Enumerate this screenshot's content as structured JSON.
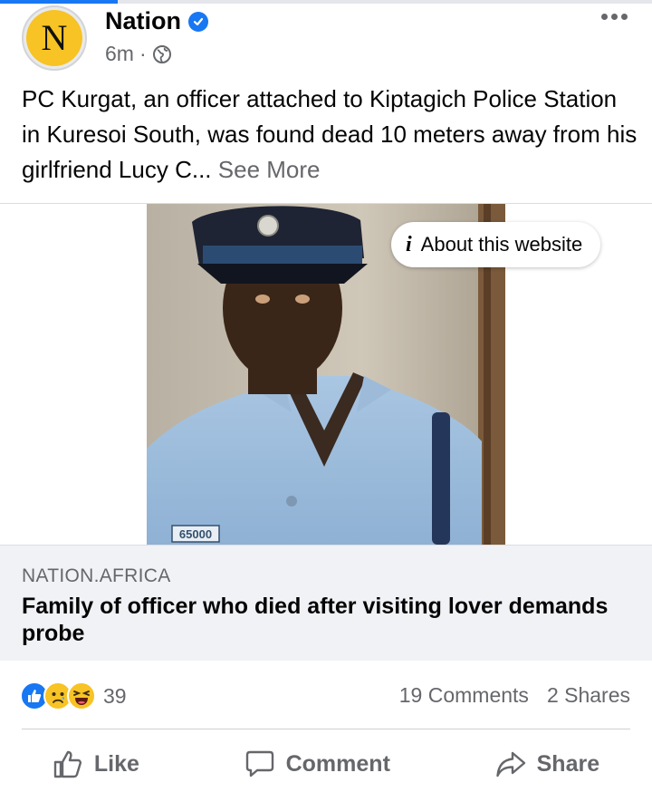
{
  "top_progress": {
    "fraction": 0.18,
    "color": "#1877f2"
  },
  "post": {
    "avatar_letter": "N",
    "page_name": "Nation",
    "time": "6m",
    "separator": "·",
    "text": "PC Kurgat, an officer attached to Kiptagich Police Station in Kuresoi South, was found dead 10 meters away from his girlfriend Lucy C...",
    "see_more": "See More"
  },
  "link_card": {
    "about_label": "About this website",
    "photo_tag": "65000",
    "domain": "NATION.AFRICA",
    "title": "Family of officer who died after visiting lover demands probe"
  },
  "stats": {
    "reaction_icons": [
      "like-icon",
      "sad-icon",
      "haha-icon"
    ],
    "reaction_count": "39",
    "comments": "19 Comments",
    "shares": "2 Shares"
  },
  "actions": {
    "like": "Like",
    "comment": "Comment",
    "share": "Share"
  },
  "colors": {
    "brand": "#1877f2",
    "secondary_text": "#65676b",
    "link_footer_bg": "#f0f2f5",
    "avatar_yellow": "#f7c325"
  }
}
